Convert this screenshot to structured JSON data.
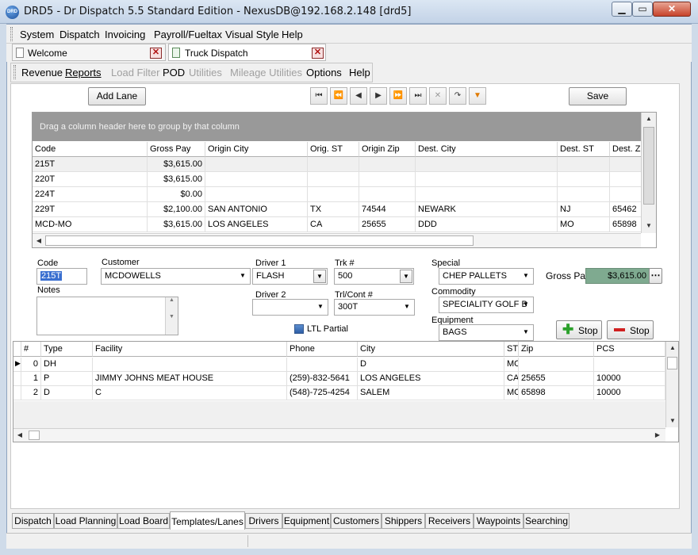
{
  "window": {
    "title": "DRD5 - Dr Dispatch 5.5 Standard Edition - NexusDB@192.168.2.148 [drd5]",
    "app_icon_text": "DRD"
  },
  "menubar": [
    "System",
    "Dispatch",
    "Invoicing",
    "Payroll/Fueltax",
    "Visual Style",
    "Help"
  ],
  "doc_tabs": [
    "Welcome",
    "Truck Dispatch"
  ],
  "toolbar": {
    "items": [
      {
        "label": "Revenue",
        "enabled": true
      },
      {
        "label": "Reports",
        "enabled": true
      },
      {
        "label": "Load Filter",
        "enabled": false
      },
      {
        "label": "POD",
        "enabled": true
      },
      {
        "label": "Utilities",
        "enabled": false
      },
      {
        "label": "Mileage Utilities",
        "enabled": false
      },
      {
        "label": "Options",
        "enabled": true
      },
      {
        "label": "Help",
        "enabled": true
      }
    ]
  },
  "actions": {
    "add_lane": "Add Lane",
    "save": "Save"
  },
  "navigator": [
    "first-icon",
    "prev-page-icon",
    "prev-icon",
    "next-icon",
    "next-page-icon",
    "last-icon",
    "cancel-icon",
    "refresh-icon",
    "filter-icon"
  ],
  "lanes_grid": {
    "group_hint": "Drag a column header here to group by that column",
    "columns": [
      "Code",
      "Gross Pay",
      "Origin City",
      "Orig. ST",
      "Origin Zip",
      "Dest. City",
      "Dest. ST",
      "Dest. Zip"
    ],
    "rows": [
      [
        "215T",
        "$3,615.00",
        "",
        "",
        "",
        "",
        "",
        ""
      ],
      [
        "220T",
        "$3,615.00",
        "",
        "",
        "",
        "",
        "",
        ""
      ],
      [
        "224T",
        "$0.00",
        "",
        "",
        "",
        "",
        "",
        ""
      ],
      [
        "229T",
        "$2,100.00",
        "SAN ANTONIO",
        "TX",
        "74544",
        "NEWARK",
        "NJ",
        "65462"
      ],
      [
        "MCD-MO",
        "$3,615.00",
        "LOS ANGELES",
        "CA",
        "25655",
        "DDD",
        "MO",
        "65898"
      ]
    ]
  },
  "form": {
    "code_label": "Code",
    "code_value": "215T",
    "customer_label": "Customer",
    "customer_value": "MCDOWELLS",
    "driver1_label": "Driver 1",
    "driver1_value": "FLASH",
    "trk_label": "Trk #",
    "trk_value": "500",
    "special_label": "Special",
    "special_value": "CHEP PALLETS",
    "gross_pay_label": "Gross Pay",
    "gross_pay_value": "$3,615.00",
    "notes_label": "Notes",
    "notes_value": "",
    "driver2_label": "Driver 2",
    "driver2_value": "",
    "trl_label": "Trl/Cont #",
    "trl_value": "300T",
    "commodity_label": "Commodity",
    "commodity_value": "SPECIALITY GOLF B",
    "equipment_label": "Equipment",
    "equipment_value": "BAGS",
    "ltl_label": "LTL Partial",
    "ltl_checked": true,
    "add_stop": "Stop",
    "remove_stop": "Stop"
  },
  "stops_grid": {
    "columns": [
      "#",
      "Type",
      "Facility",
      "Phone",
      "City",
      "ST",
      "Zip",
      "PCS"
    ],
    "rows": [
      [
        "0",
        "DH",
        "",
        "",
        "D",
        "MO",
        "",
        ""
      ],
      [
        "1",
        "P",
        "JIMMY JOHNS MEAT HOUSE",
        "(259)-832-5641",
        "LOS ANGELES",
        "CA",
        "25655",
        "10000"
      ],
      [
        "2",
        "D",
        "C",
        "(548)-725-4254",
        "SALEM",
        "MO",
        "65898",
        "10000"
      ]
    ]
  },
  "bottom_tabs": [
    "Dispatch",
    "Load Planning",
    "Load Board",
    "Templates/Lanes",
    "Drivers",
    "Equipment",
    "Customers",
    "Shippers",
    "Receivers",
    "Waypoints",
    "Searching"
  ],
  "active_bottom_tab": "Templates/Lanes",
  "colors": {
    "gross_pay_bg": "#7faa90",
    "group_panel": "#999999",
    "code_highlight": "#3a6fd0"
  }
}
